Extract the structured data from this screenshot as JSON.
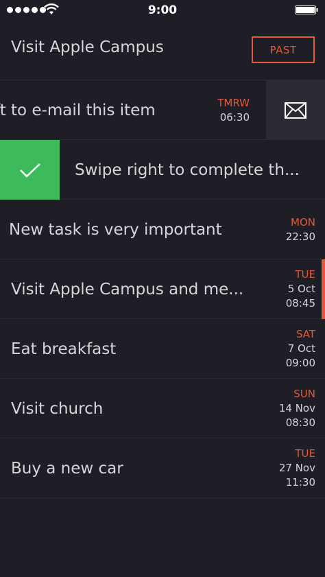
{
  "status_bar": {
    "time": "9:00",
    "signal_dots": 5
  },
  "header": {
    "title": "Visit Apple Campus",
    "past_button": "PAST"
  },
  "swipe_left_row": {
    "title": "ft to e-mail this item",
    "day": "TMRW",
    "time": "06:30",
    "action_icon": "mail-icon"
  },
  "swipe_right_row": {
    "title": "Swipe right to complete th...",
    "action_icon": "check-icon"
  },
  "tasks": [
    {
      "title": "New task is very important",
      "day": "MON",
      "date": "",
      "time": "22:30"
    },
    {
      "title": "Visit Apple Campus and me...",
      "day": "TUE",
      "date": "5 Oct",
      "time": "08:45",
      "active": true
    },
    {
      "title": "Eat breakfast",
      "day": "SAT",
      "date": "7 Oct",
      "time": "09:00"
    },
    {
      "title": "Visit church",
      "day": "SUN",
      "date": "14 Nov",
      "time": "08:30"
    },
    {
      "title": "Buy a new car",
      "day": "TUE",
      "date": "27 Nov",
      "time": "11:30"
    }
  ],
  "colors": {
    "background": "#1e1f26",
    "accent": "#e05a3a",
    "complete": "#3dbb5c",
    "action_bg": "#2a2b33"
  }
}
